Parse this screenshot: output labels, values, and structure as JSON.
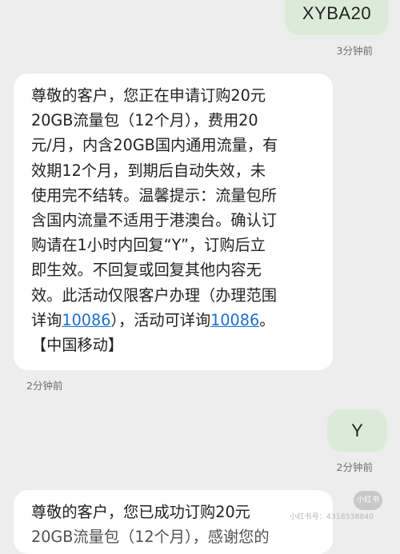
{
  "messages": {
    "sent1": {
      "text": "XYBA20",
      "time": "3分钟前"
    },
    "recv1": {
      "lines": [
        "尊敬的客户，您正在申请订购20元",
        "20GB流量包（12个月），费用20",
        "元/月，内含20GB国内通用流量，有",
        "效期12个月，到期后自动失效，未",
        "使用完不结转。温馨提示：流量包所",
        "含国内流量不适用于港澳台。确认订",
        "购请在1小时内回复“Y”，订购后立",
        "即生效。不回复或回复其他内容无",
        "效。此活动仅限客户办理（办理范围"
      ],
      "line10_prefix": "详询",
      "link1": "10086",
      "line10_mid": "），活动可详询",
      "link2": "10086",
      "line10_suffix": "。",
      "signature": "【中国移动】",
      "time": "2分钟前"
    },
    "sent2": {
      "text": "Y",
      "time": "2分钟前"
    },
    "recv2": {
      "line1": "尊敬的客户，您已成功订购20元",
      "line2": "20GB流量包（12个月），感谢您的"
    }
  },
  "watermark": {
    "badge": "小红书",
    "text": "小红书号：4318538840"
  },
  "colors": {
    "background": "#ededed",
    "sent_bubble": "#dcebd9",
    "received_bubble": "#ffffff",
    "link": "#1b6fcf"
  }
}
